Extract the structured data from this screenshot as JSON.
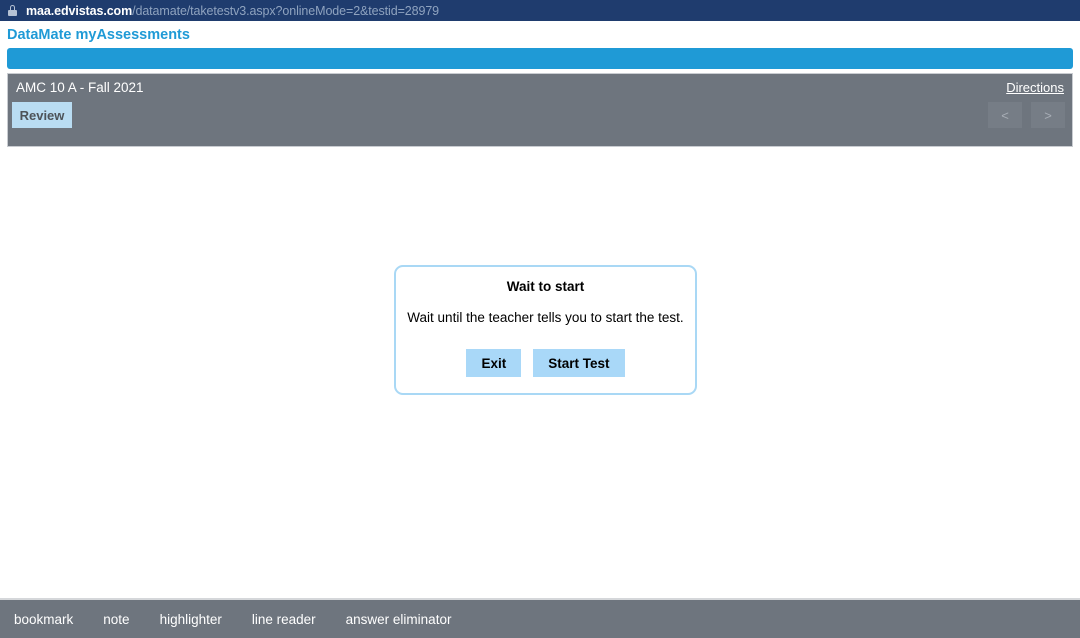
{
  "browser": {
    "lock_icon": "lock-icon",
    "url_domain": "maa.edvistas.com",
    "url_path": "/datamate/taketestv3.aspx?onlineMode=2&testid=28979"
  },
  "app": {
    "brand_title": "DataMate myAssessments"
  },
  "test_header": {
    "title": "AMC 10 A - Fall 2021",
    "directions_label": "Directions",
    "review_label": "Review",
    "prev_label": "<",
    "next_label": ">"
  },
  "modal": {
    "title": "Wait to start",
    "message": "Wait until the teacher tells you to start the test.",
    "exit_label": "Exit",
    "start_label": "Start Test"
  },
  "bottom_toolbar": {
    "items": [
      {
        "label": "bookmark"
      },
      {
        "label": "note"
      },
      {
        "label": "highlighter"
      },
      {
        "label": "line reader"
      },
      {
        "label": "answer eliminator"
      }
    ]
  },
  "colors": {
    "urlbar_bg": "#1f3c6e",
    "accent_blue": "#1f9ad6",
    "header_gray": "#6e757e",
    "button_light_blue": "#a9d8f8",
    "review_blue": "#b9dcf2",
    "modal_border": "#a9d8f5"
  }
}
